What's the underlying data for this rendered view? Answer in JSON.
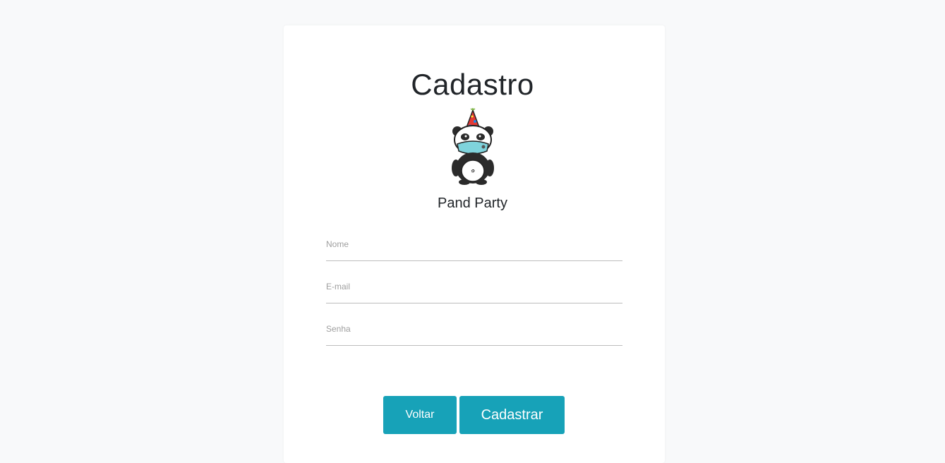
{
  "page": {
    "title": "Cadastro",
    "brand_name": "Pand Party",
    "logo_icon": "party-panda-icon"
  },
  "form": {
    "fields": [
      {
        "label": "Nome",
        "value": ""
      },
      {
        "label": "E-mail",
        "value": ""
      },
      {
        "label": "Senha",
        "value": ""
      }
    ]
  },
  "actions": {
    "back_label": "Voltar",
    "submit_label": "Cadastrar"
  },
  "colors": {
    "button": "#17a2b8",
    "background": "#f8f9fa",
    "card": "#ffffff",
    "text": "#212529"
  }
}
